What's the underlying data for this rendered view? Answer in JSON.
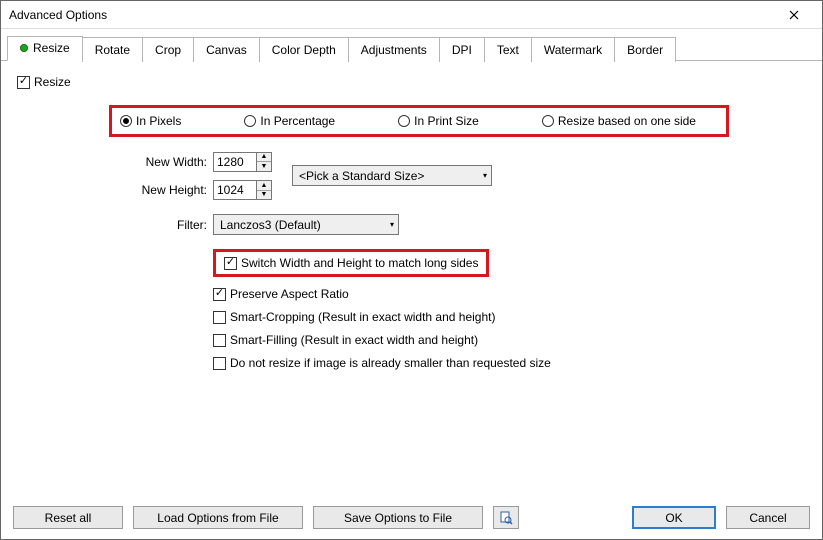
{
  "window": {
    "title": "Advanced Options"
  },
  "tabs": {
    "items": [
      {
        "label": "Resize",
        "active": true
      },
      {
        "label": "Rotate"
      },
      {
        "label": "Crop"
      },
      {
        "label": "Canvas"
      },
      {
        "label": "Color Depth"
      },
      {
        "label": "Adjustments"
      },
      {
        "label": "DPI"
      },
      {
        "label": "Text"
      },
      {
        "label": "Watermark"
      },
      {
        "label": "Border"
      }
    ]
  },
  "resize": {
    "enable_label": "Resize",
    "enable_checked": true,
    "modes": {
      "pixels": "In Pixels",
      "percentage": "In Percentage",
      "print": "In Print Size",
      "oneside": "Resize based on one side",
      "selected": "pixels"
    },
    "width_label": "New Width:",
    "width_value": "1280",
    "height_label": "New Height:",
    "height_value": "1024",
    "standard_size": "<Pick a Standard Size>",
    "filter_label": "Filter:",
    "filter_value": "Lanczos3 (Default)",
    "switch_long_sides": {
      "label": "Switch Width and Height to match long sides",
      "checked": true
    },
    "preserve_aspect": {
      "label": "Preserve Aspect Ratio",
      "checked": true
    },
    "smart_crop": {
      "label": "Smart-Cropping (Result in exact width and height)",
      "checked": false
    },
    "smart_fill": {
      "label": "Smart-Filling (Result in exact width and height)",
      "checked": false
    },
    "no_upscale": {
      "label": "Do not resize if image is already smaller than requested size",
      "checked": false
    }
  },
  "footer": {
    "reset": "Reset all",
    "load": "Load Options from File",
    "save": "Save Options to File",
    "ok": "OK",
    "cancel": "Cancel"
  }
}
